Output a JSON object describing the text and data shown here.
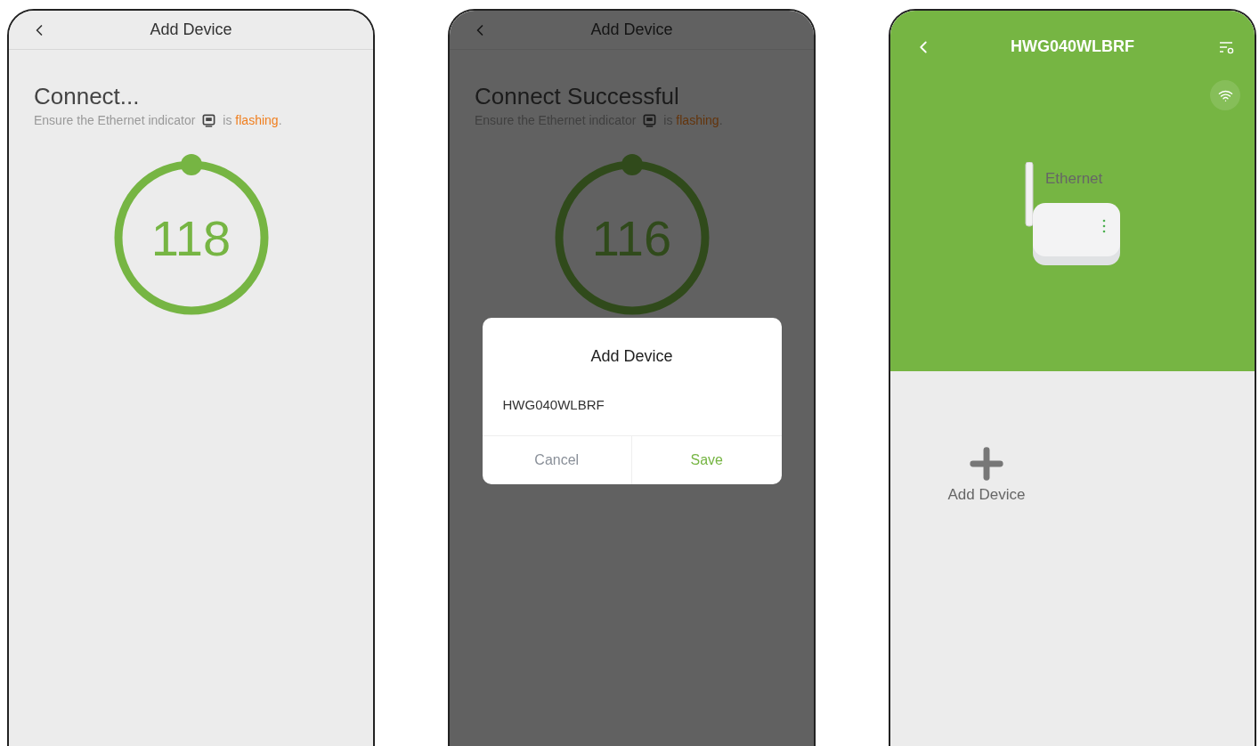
{
  "screens": [
    {
      "kind": "connect",
      "title": "Add Device",
      "heading": "Connect...",
      "hint": {
        "lead": "Ensure the Ethernet indicator",
        "status_prefix": "is",
        "status_word": "flashing",
        "status_suffix": "."
      },
      "countdown": "118"
    },
    {
      "kind": "connect",
      "title": "Add Device",
      "heading": "Connect Successful",
      "hint": {
        "lead": "Ensure the Ethernet indicator",
        "status_prefix": "is",
        "status_word": "flashing",
        "status_suffix": "."
      },
      "countdown": "116",
      "dialog": {
        "title": "Add Device",
        "value": "HWG040WLBRF",
        "buttons": [
          {
            "label": "Cancel",
            "kind": "cancel"
          },
          {
            "label": "Save",
            "kind": "confirm"
          }
        ]
      }
    },
    {
      "kind": "device",
      "title": "HWG040WLBRF",
      "device_label": "Ethernet",
      "add_label": "Add Device"
    }
  ]
}
